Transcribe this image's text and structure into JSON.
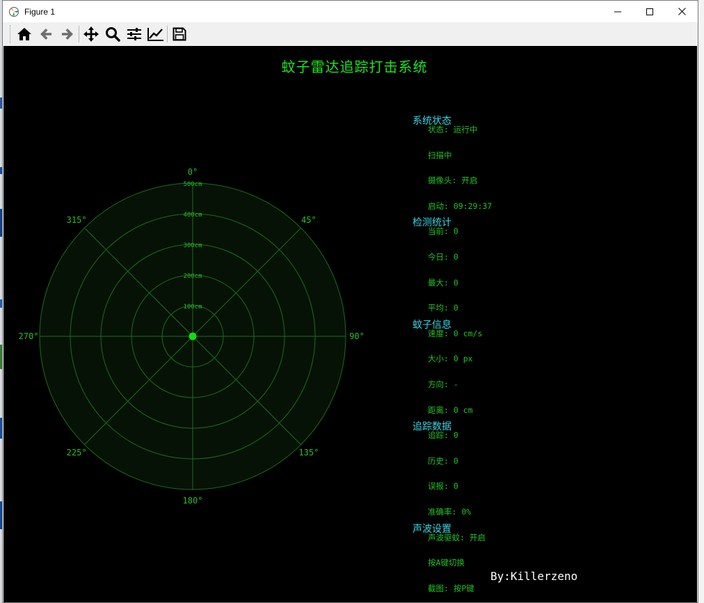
{
  "window": {
    "title": "Figure 1",
    "controls": [
      "minimize",
      "maximize",
      "close"
    ]
  },
  "toolbar": {
    "buttons": [
      {
        "name": "home",
        "icon": "home-icon"
      },
      {
        "name": "back",
        "icon": "arrow-left-icon"
      },
      {
        "name": "forward",
        "icon": "arrow-right-icon"
      },
      {
        "name": "pan",
        "icon": "move-icon"
      },
      {
        "name": "zoom",
        "icon": "zoom-icon"
      },
      {
        "name": "configure-subplots",
        "icon": "sliders-icon"
      },
      {
        "name": "edit-axis",
        "icon": "chart-line-icon"
      },
      {
        "name": "save",
        "icon": "save-icon"
      }
    ]
  },
  "figure": {
    "title": "蚊子雷达追踪打击系统",
    "signature": "By:Killerzeno"
  },
  "radar": {
    "angle_labels": [
      "0°",
      "45°",
      "90°",
      "135°",
      "180°",
      "225°",
      "270°",
      "315°"
    ],
    "range_labels": [
      "100cm",
      "200cm",
      "300cm",
      "400cm",
      "500cm"
    ],
    "colors": {
      "background": "#000000",
      "grid": "#1a6e1a",
      "label": "#22c322",
      "center": "#11dd11"
    }
  },
  "info_panel": {
    "sections": [
      {
        "title": "系统状态",
        "items": [
          "状态: 运行中",
          "扫描中",
          "摄像头: 开启",
          "启动: 09:29:37"
        ]
      },
      {
        "title": "检测统计",
        "items": [
          "当前: 0",
          "今日: 0",
          "最大: 0",
          "平均: 0"
        ]
      },
      {
        "title": "蚊子信息",
        "items": [
          "速度: 0 cm/s",
          "大小: 0 px",
          "方向: -",
          "距离: 0 cm"
        ]
      },
      {
        "title": "追踪数据",
        "items": [
          "追踪: 0",
          "历史: 0",
          "误报: 0",
          "准确率: 0%"
        ]
      },
      {
        "title": "声波设置",
        "items": [
          "声波驱蚊: 开启",
          "按A键切换",
          "截图: 按P键"
        ]
      }
    ],
    "colors": {
      "section_title": "#35d6e6",
      "item": "#22c322"
    }
  }
}
